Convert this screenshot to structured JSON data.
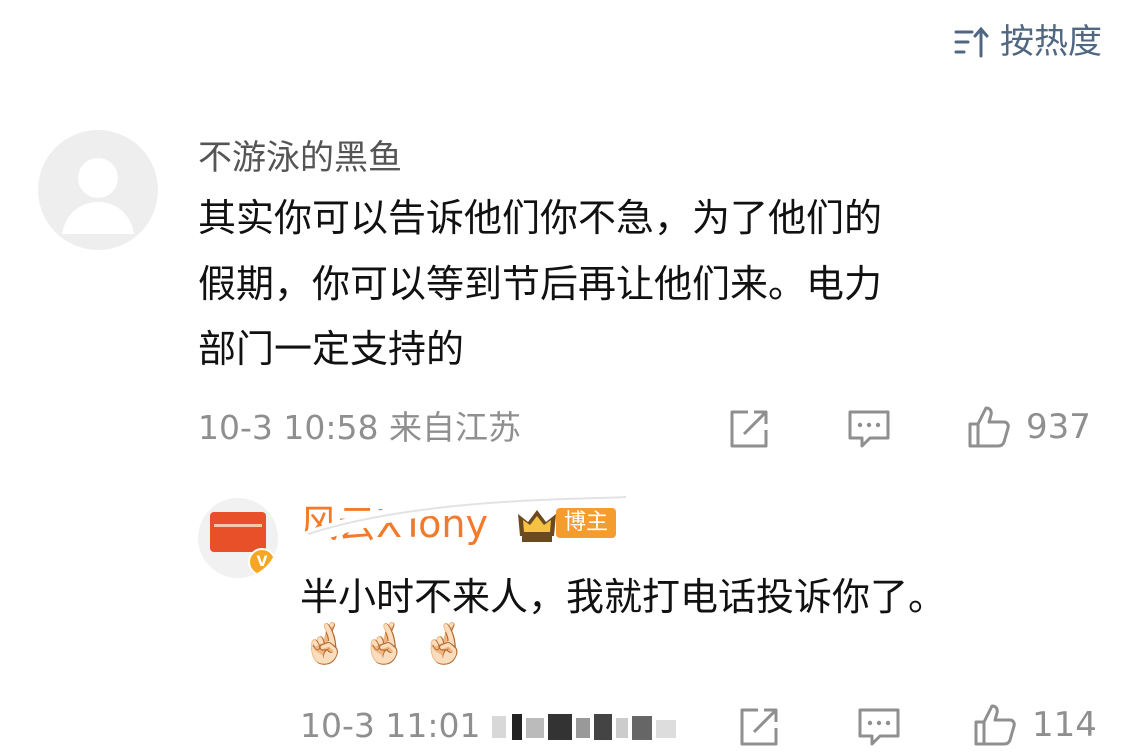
{
  "header": {
    "sort_label": "按热度",
    "sort_icon": "sort-icon"
  },
  "comments": [
    {
      "author": "不游泳的黑鱼",
      "text_lines": [
        "其实你可以告诉他们你不急，为了他们的",
        "假期，你可以等到节后再让他们来。电力",
        "部门一定支持的"
      ],
      "meta": "10-3 10:58  来自江苏",
      "like_count": "937"
    }
  ],
  "reply": {
    "author": "风云XTony",
    "badge": "博主",
    "text": "半小时不来人，我就打电话投诉你了。",
    "emojis": [
      "🤞🏻",
      "🤞🏻",
      "🤞🏻"
    ],
    "meta": "10-3 11:01",
    "like_count": "114"
  },
  "colors": {
    "accent": "#4f6781",
    "name_orange": "#f27b2b",
    "badge_orange": "#f59c2e",
    "meta_gray": "#8f8f8f"
  }
}
